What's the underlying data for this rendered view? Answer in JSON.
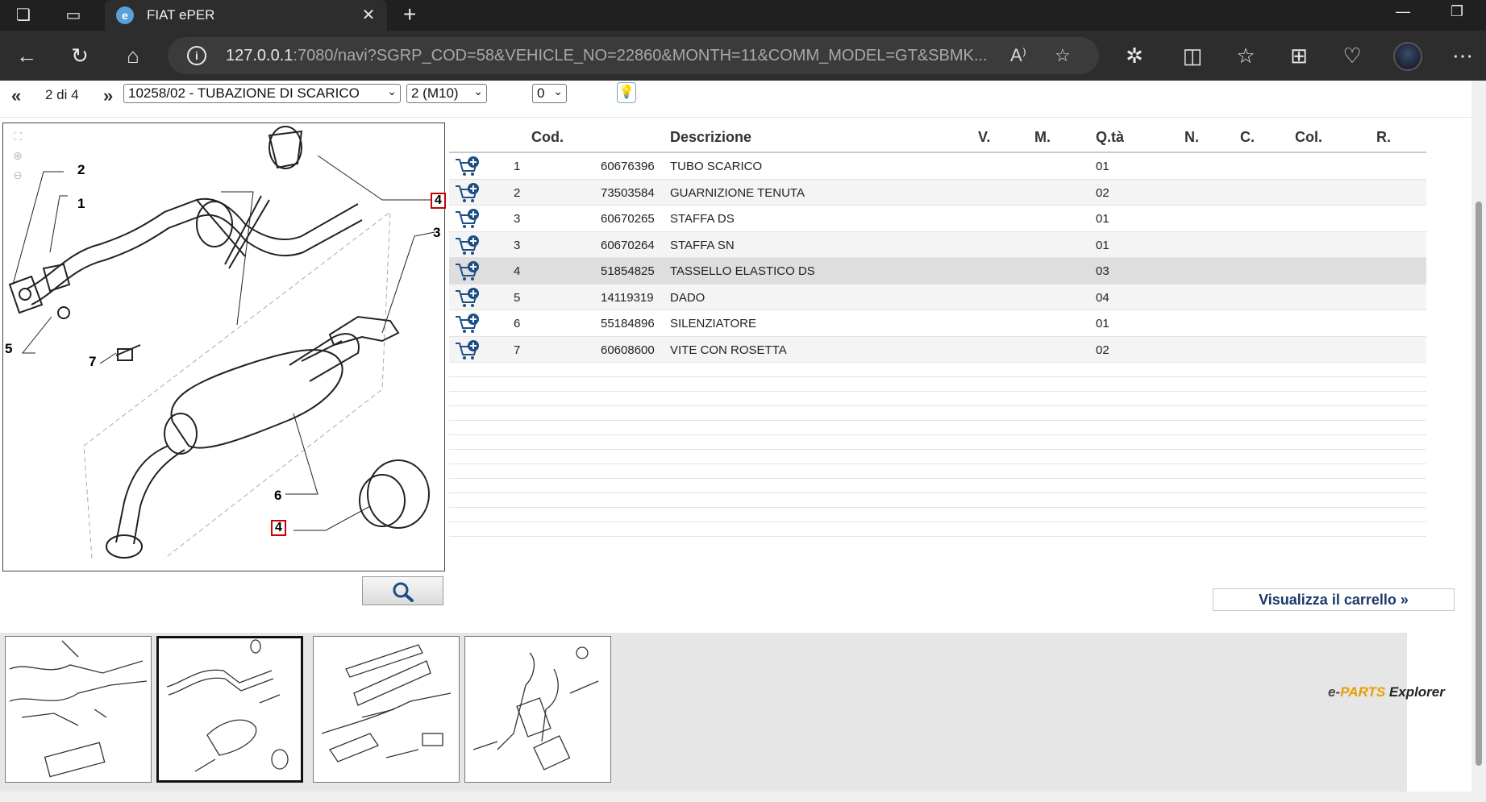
{
  "browser": {
    "tab_title": "FIAT ePER",
    "url_host": "127.0.0.1",
    "url_rest": ":7080/navi?SGRP_COD=58&VEHICLE_NO=22860&MONTH=11&COMM_MODEL=GT&SBMK..."
  },
  "header": {
    "prev_label": "«",
    "page_text": "2 di 4",
    "next_label": "»",
    "table_select": "10258/02 - TUBAZIONE DI SCARICO",
    "variant_select": "2 (M10)",
    "count_select": "0"
  },
  "diagram": {
    "callouts": [
      "2",
      "1",
      "4",
      "3",
      "5",
      "7",
      "6",
      "4"
    ]
  },
  "table": {
    "headers": {
      "cod": "Cod.",
      "desc": "Descrizione",
      "v": "V.",
      "m": "M.",
      "qty": "Q.tà",
      "n": "N.",
      "c": "C.",
      "col": "Col.",
      "r": "R."
    },
    "rows": [
      {
        "ref": "1",
        "code": "60676396",
        "desc": "TUBO SCARICO",
        "qty": "01"
      },
      {
        "ref": "2",
        "code": "73503584",
        "desc": "GUARNIZIONE TENUTA",
        "qty": "02"
      },
      {
        "ref": "3",
        "code": "60670265",
        "desc": "STAFFA DS",
        "qty": "01"
      },
      {
        "ref": "3",
        "code": "60670264",
        "desc": "STAFFA SN",
        "qty": "01"
      },
      {
        "ref": "4",
        "code": "51854825",
        "desc": "TASSELLO ELASTICO DS",
        "qty": "03"
      },
      {
        "ref": "5",
        "code": "14119319",
        "desc": "DADO",
        "qty": "04"
      },
      {
        "ref": "6",
        "code": "55184896",
        "desc": "SILENZIATORE",
        "qty": "01"
      },
      {
        "ref": "7",
        "code": "60608600",
        "desc": "VITE CON ROSETTA",
        "qty": "02"
      }
    ]
  },
  "cart_link": "Visualizza il carrello »",
  "brand": {
    "e": "e-",
    "parts": "PARTS",
    "explorer": " Explorer"
  }
}
